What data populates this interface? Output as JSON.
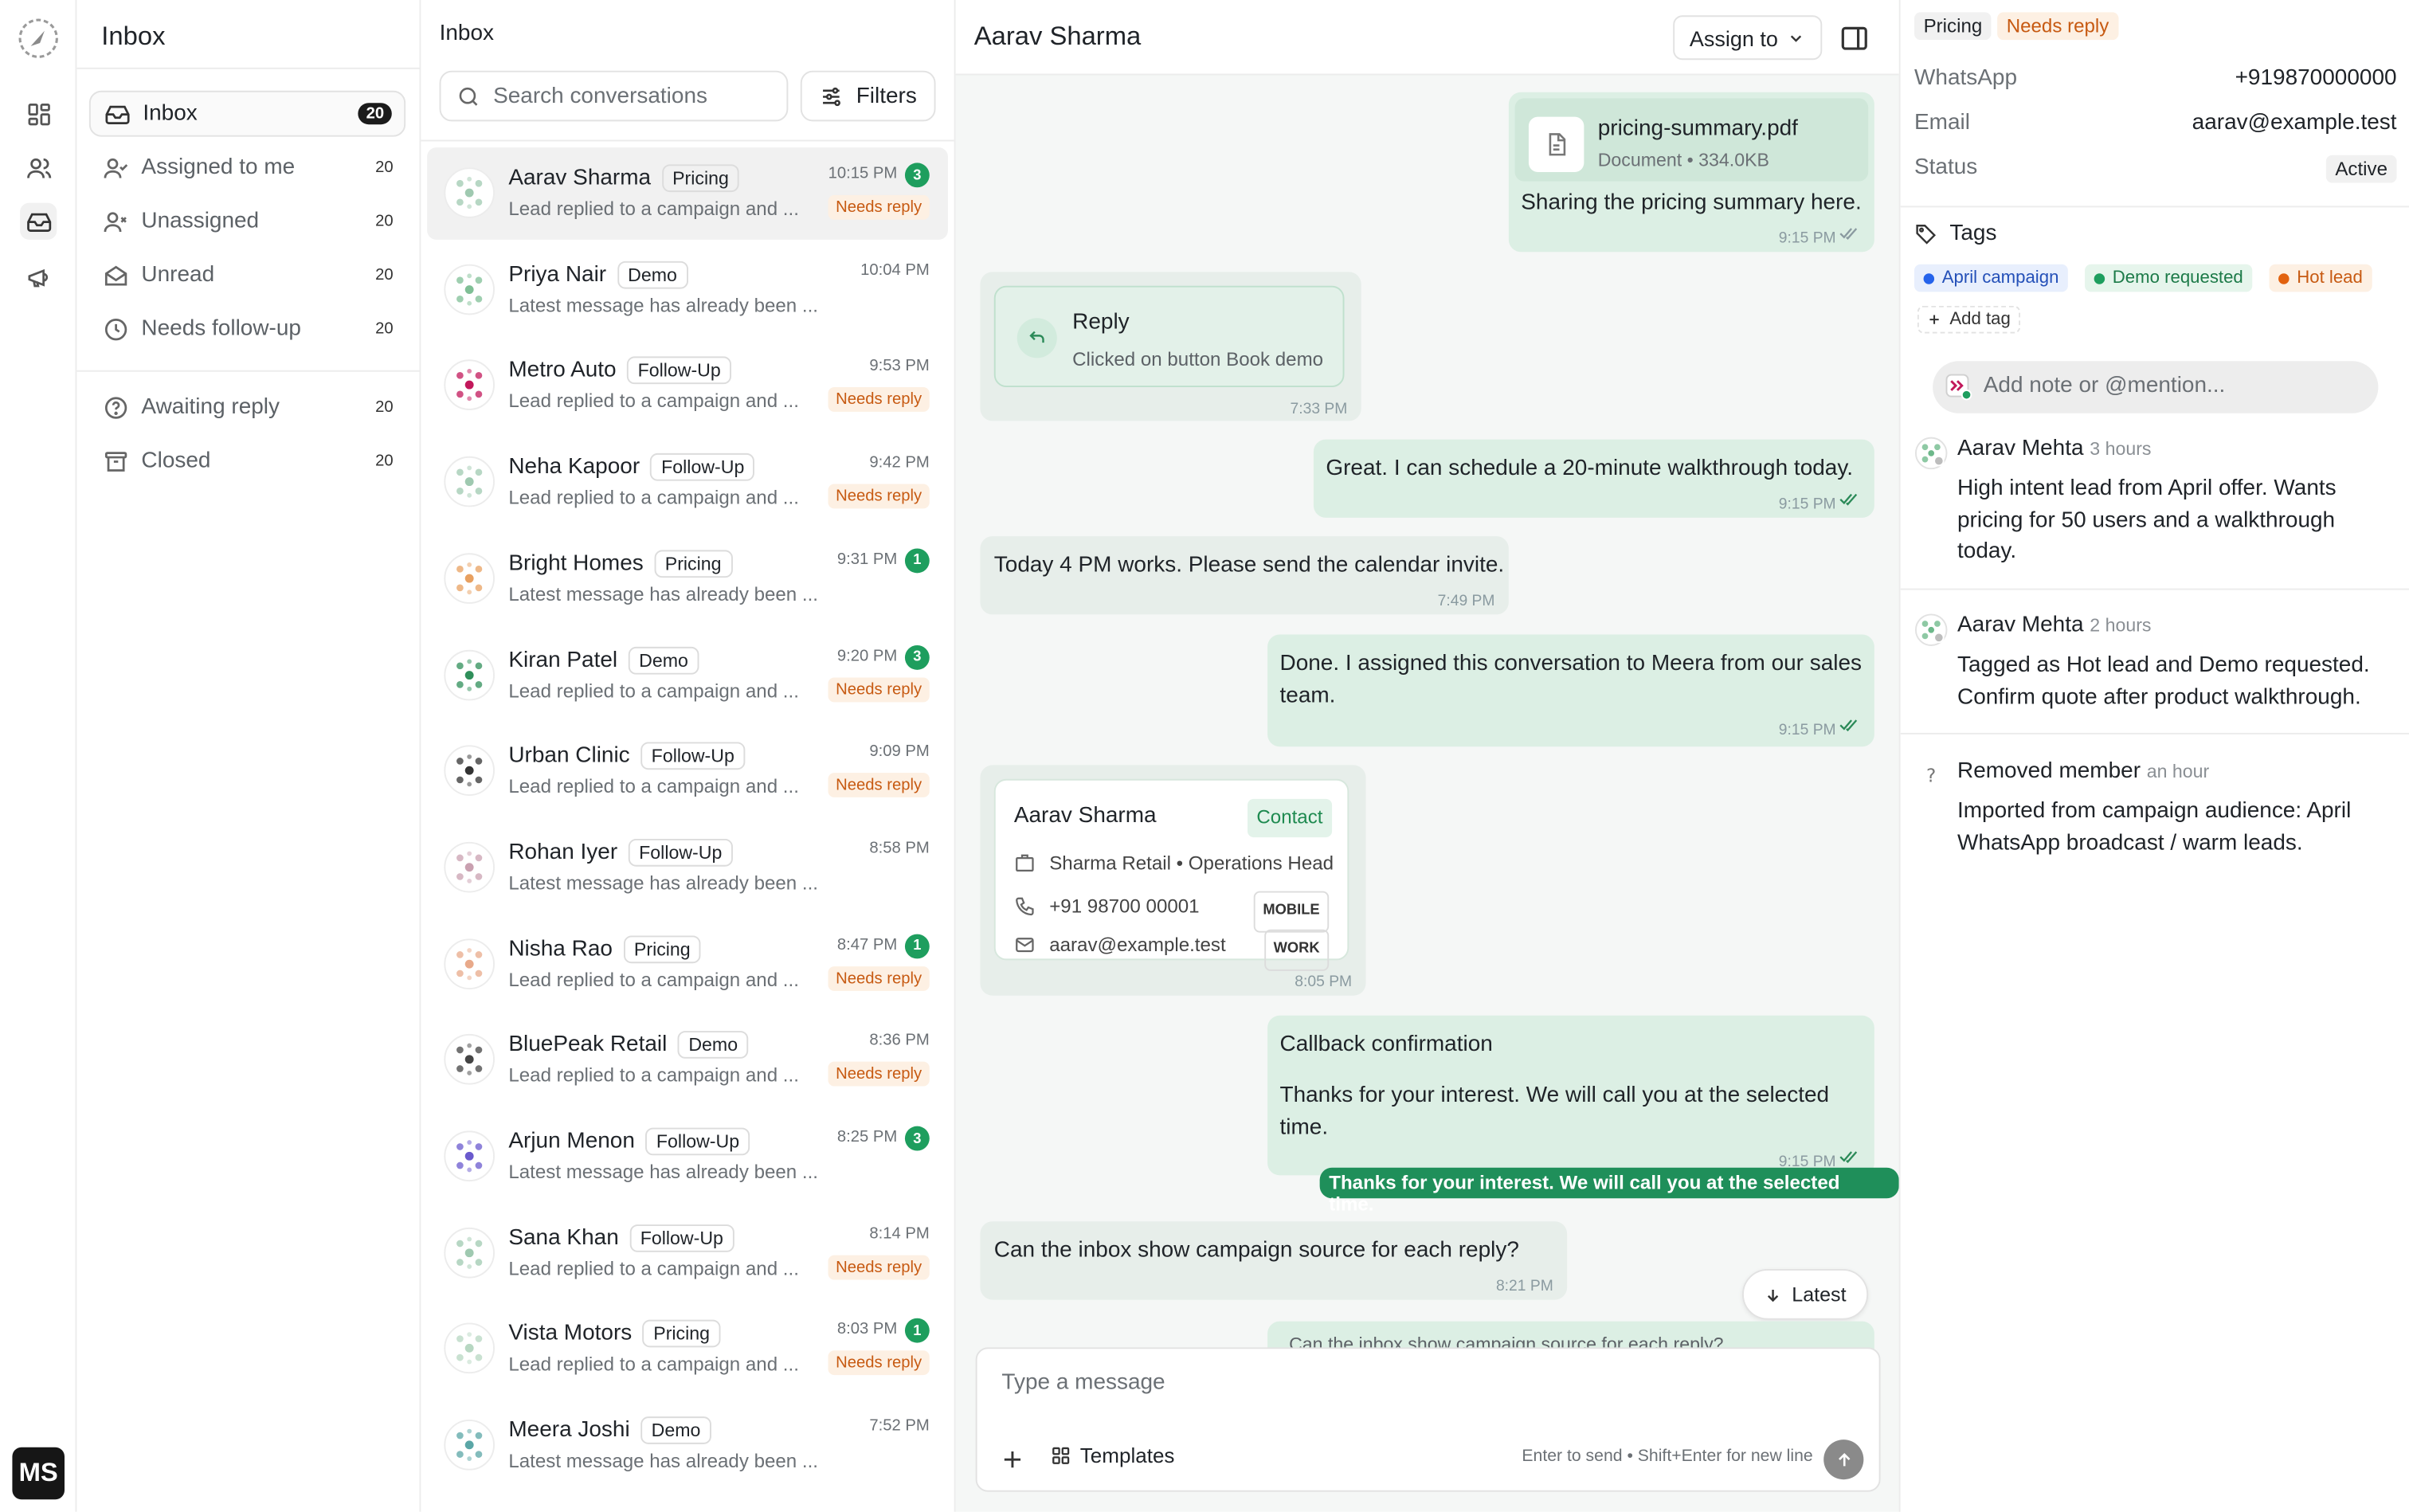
{
  "rail": {
    "brand": "MS"
  },
  "sidebar": {
    "title": "Inbox",
    "items": [
      {
        "label": "Inbox",
        "count": "20",
        "icon": "inbox-icon"
      },
      {
        "label": "Assigned to me",
        "count": "20",
        "icon": "user-check-icon"
      },
      {
        "label": "Unassigned",
        "count": "20",
        "icon": "user-x-icon"
      },
      {
        "label": "Unread",
        "count": "20",
        "icon": "mail-open-icon"
      },
      {
        "label": "Needs follow-up",
        "count": "20",
        "icon": "clock-icon"
      },
      {
        "label": "Awaiting reply",
        "count": "20",
        "icon": "help-circle-icon"
      },
      {
        "label": "Closed",
        "count": "20",
        "icon": "archive-icon"
      }
    ]
  },
  "list": {
    "title": "Inbox",
    "search_placeholder": "Search conversations",
    "filters_label": "Filters",
    "conversations": [
      {
        "name": "Aarav Sharma",
        "tag": "Pricing",
        "preview": "Lead replied to a campaign and ...",
        "time": "10:15 PM",
        "unread": "3",
        "status": "Needs reply"
      },
      {
        "name": "Priya Nair",
        "tag": "Demo",
        "preview": "Latest message has already been ...",
        "time": "10:04 PM",
        "unread": "",
        "status": ""
      },
      {
        "name": "Metro Auto",
        "tag": "Follow-Up",
        "preview": "Lead replied to a campaign and ...",
        "time": "9:53 PM",
        "unread": "",
        "status": "Needs reply"
      },
      {
        "name": "Neha Kapoor",
        "tag": "Follow-Up",
        "preview": "Lead replied to a campaign and ...",
        "time": "9:42 PM",
        "unread": "",
        "status": "Needs reply"
      },
      {
        "name": "Bright Homes",
        "tag": "Pricing",
        "preview": "Latest message has already been ...",
        "time": "9:31 PM",
        "unread": "1",
        "status": ""
      },
      {
        "name": "Kiran Patel",
        "tag": "Demo",
        "preview": "Lead replied to a campaign and ...",
        "time": "9:20 PM",
        "unread": "3",
        "status": "Needs reply"
      },
      {
        "name": "Urban Clinic",
        "tag": "Follow-Up",
        "preview": "Lead replied to a campaign and ...",
        "time": "9:09 PM",
        "unread": "",
        "status": "Needs reply"
      },
      {
        "name": "Rohan Iyer",
        "tag": "Follow-Up",
        "preview": "Latest message has already been ...",
        "time": "8:58 PM",
        "unread": "",
        "status": ""
      },
      {
        "name": "Nisha Rao",
        "tag": "Pricing",
        "preview": "Lead replied to a campaign and ...",
        "time": "8:47 PM",
        "unread": "1",
        "status": "Needs reply"
      },
      {
        "name": "BluePeak Retail",
        "tag": "Demo",
        "preview": "Lead replied to a campaign and ...",
        "time": "8:36 PM",
        "unread": "",
        "status": "Needs reply"
      },
      {
        "name": "Arjun Menon",
        "tag": "Follow-Up",
        "preview": "Latest message has already been ...",
        "time": "8:25 PM",
        "unread": "3",
        "status": ""
      },
      {
        "name": "Sana Khan",
        "tag": "Follow-Up",
        "preview": "Lead replied to a campaign and ...",
        "time": "8:14 PM",
        "unread": "",
        "status": "Needs reply"
      },
      {
        "name": "Vista Motors",
        "tag": "Pricing",
        "preview": "Lead replied to a campaign and ...",
        "time": "8:03 PM",
        "unread": "1",
        "status": "Needs reply"
      },
      {
        "name": "Meera Joshi",
        "tag": "Demo",
        "preview": "Latest message has already been ...",
        "time": "7:52 PM",
        "unread": "",
        "status": ""
      }
    ]
  },
  "chat": {
    "name": "Aarav Sharma",
    "assign_label": "Assign to",
    "messages": {
      "m1": {
        "file_name": "pricing-summary.pdf",
        "file_meta": "Document • 334.0KB",
        "text": "Sharing the pricing summary here.",
        "time": "9:15 PM"
      },
      "m2": {
        "title": "Reply",
        "subtitle": "Clicked on button Book demo",
        "time": "7:33 PM"
      },
      "m3": {
        "text": "Great. I can schedule a 20-minute walkthrough today.",
        "time": "9:15 PM"
      },
      "m4": {
        "text": "Today 4 PM works. Please send the calendar invite.",
        "time": "7:49 PM"
      },
      "m5": {
        "text": "Done. I assigned this conversation to Meera from our sales team.",
        "time": "9:15 PM"
      },
      "m6": {
        "name": "Aarav Sharma",
        "badge": "Contact",
        "company": "Sharma Retail • Operations Head",
        "phone": "+91 98700 00001",
        "phone_type": "MOBILE",
        "email": "aarav@example.test",
        "email_type": "WORK",
        "time": "8:05 PM"
      },
      "m7": {
        "title": "Callback confirmation",
        "body": "Thanks for your interest. We will call you at the selected time.",
        "time": "9:15 PM",
        "quick_reply": "Thanks for your interest. We will call you at the selected time."
      },
      "m8": {
        "text": "Can the inbox show campaign source for each reply?",
        "time": "8:21 PM"
      },
      "m9": {
        "text": "Can the inbox show campaign source for each reply?"
      }
    },
    "latest_label": "Latest",
    "composer_placeholder": "Type a message",
    "templates_label": "Templates",
    "composer_hint": "Enter to send • Shift+Enter for new line"
  },
  "details": {
    "chips": [
      "Pricing",
      "Needs reply"
    ],
    "whatsapp_label": "WhatsApp",
    "whatsapp": "+919870000000",
    "email_label": "Email",
    "email": "aarav@example.test",
    "status_label": "Status",
    "status": "Active",
    "tags_title": "Tags",
    "tags": [
      {
        "label": "April campaign",
        "color": "#2563eb",
        "bg": "#e8effd",
        "fg": "#2450b8"
      },
      {
        "label": "Demo requested",
        "color": "#1e9e5e",
        "bg": "#e6f5ec",
        "fg": "#1c7a48"
      },
      {
        "label": "Hot lead",
        "color": "#e2620f",
        "bg": "#fdf0e3",
        "fg": "#c75a12"
      }
    ],
    "add_tag_label": "Add tag",
    "note_placeholder": "Add note or @mention...",
    "activity": [
      {
        "author": "Aarav Mehta",
        "ago": "3 hours",
        "text": "High intent lead from April offer. Wants pricing for 50 users and a walkthrough today."
      },
      {
        "author": "Aarav Mehta",
        "ago": "2 hours",
        "text": "Tagged as Hot lead and Demo requested. Confirm quote after product walkthrough."
      },
      {
        "author": "Removed member",
        "ago": "an hour",
        "text": "Imported from campaign audience: April WhatsApp broadcast / warm leads."
      }
    ]
  }
}
